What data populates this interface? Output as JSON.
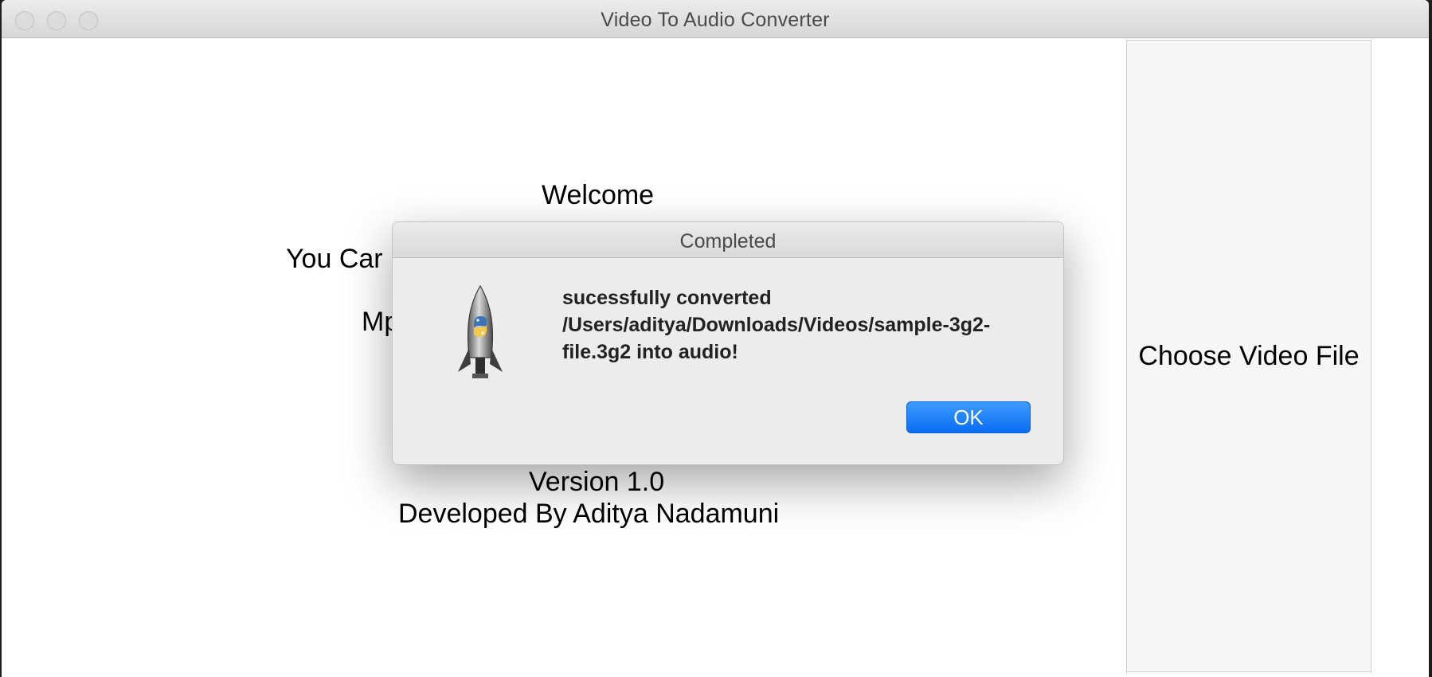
{
  "window": {
    "title": "Video To Audio Converter"
  },
  "main": {
    "welcome": "Welcome",
    "you_can_partial": "You Car",
    "mp_partial": "Mp",
    "version": "Version 1.0",
    "developed_by": "Developed By Aditya Nadamuni",
    "choose_button_label": "Choose Video File"
  },
  "dialog": {
    "title": "Completed",
    "message": "sucessfully converted /Users/aditya/Downloads/Videos/sample-3g2-file.3g2 into audio!",
    "ok_label": "OK",
    "icon": "python-launcher-rocket-icon"
  },
  "colors": {
    "ok_button": "#0a6cf3",
    "dialog_background": "#ececec",
    "titlebar": "#d6d6d6"
  }
}
